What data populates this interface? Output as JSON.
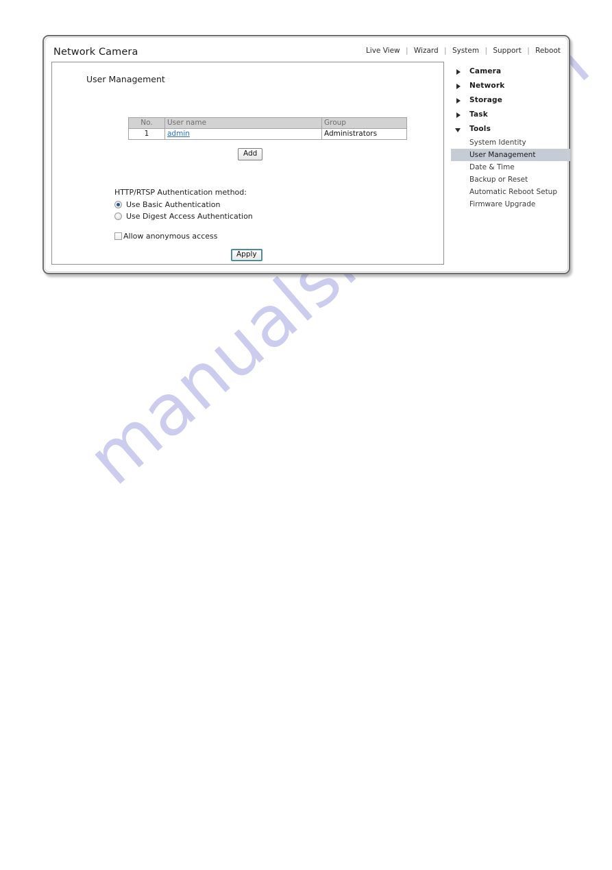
{
  "watermark": {
    "text": "manualshive.com"
  },
  "header": {
    "brand": "Network Camera",
    "nav": [
      {
        "label": "Live View"
      },
      {
        "label": "Wizard"
      },
      {
        "label": "System"
      },
      {
        "label": "Support"
      },
      {
        "label": "Reboot"
      }
    ],
    "separator": "|"
  },
  "main": {
    "section_title": "User Management",
    "table": {
      "columns": [
        "No.",
        "User name",
        "Group"
      ],
      "rows": [
        {
          "no": "1",
          "user_name": "admin",
          "group": "Administrators"
        }
      ]
    },
    "add_button": "Add",
    "auth": {
      "label": "HTTP/RTSP Authentication method:",
      "options": [
        {
          "label": "Use Basic Authentication",
          "selected": true
        },
        {
          "label": "Use Digest Access Authentication",
          "selected": false
        }
      ],
      "anonymous": {
        "label": "Allow anonymous access",
        "checked": false
      }
    },
    "apply_button": "Apply"
  },
  "sidebar": {
    "groups": [
      {
        "label": "Camera",
        "expanded": false
      },
      {
        "label": "Network",
        "expanded": false
      },
      {
        "label": "Storage",
        "expanded": false
      },
      {
        "label": "Task",
        "expanded": false
      },
      {
        "label": "Tools",
        "expanded": true
      }
    ],
    "tools_children": [
      {
        "label": "System Identity",
        "active": false
      },
      {
        "label": "User Management",
        "active": true
      },
      {
        "label": "Date & Time",
        "active": false
      },
      {
        "label": "Backup or Reset",
        "active": false
      },
      {
        "label": "Automatic Reboot Setup",
        "active": false
      },
      {
        "label": "Firmware Upgrade",
        "active": false
      }
    ]
  },
  "colors": {
    "link": "#2a6ec4",
    "table_header_bg": "#d2d2d2",
    "sidebar_active_bg": "#c6ccd6",
    "radio_dot": "#28528e",
    "apply_focus_border": "#4d8a9e",
    "watermark": "#b9b9e8"
  }
}
